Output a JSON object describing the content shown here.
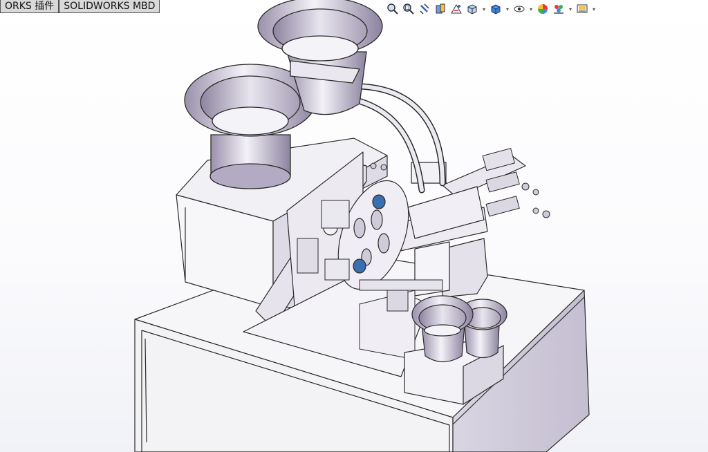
{
  "tabs": [
    {
      "label": "ORKS 插件"
    },
    {
      "label": "SOLIDWORKS MBD"
    }
  ],
  "heads_up_toolbar": [
    {
      "icon": "zoom-to-fit-icon"
    },
    {
      "icon": "zoom-to-area-icon"
    },
    {
      "icon": "previous-view-icon"
    },
    {
      "icon": "section-view-icon"
    },
    {
      "icon": "dynamic-annotation-views-icon"
    },
    {
      "icon": "view-orientation-icon"
    },
    {
      "icon": "display-style-icon"
    },
    {
      "icon": "hide-show-items-icon"
    },
    {
      "icon": "edit-appearance-icon"
    },
    {
      "icon": "apply-scene-icon"
    },
    {
      "icon": "view-settings-icon"
    }
  ],
  "colors": {
    "metal_light": "#e8e6ee",
    "metal_mid": "#cfcbd8",
    "metal_dark": "#a9a2b8",
    "edge": "#2a2a2a",
    "accent_blue": "#3a6fb0"
  }
}
